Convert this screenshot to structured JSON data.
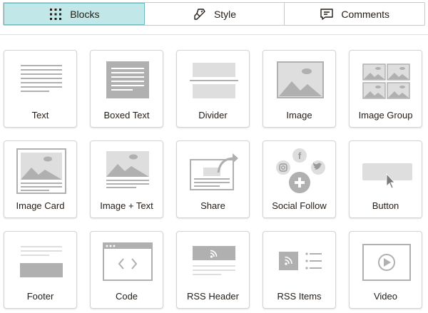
{
  "tabs": [
    {
      "label": "Blocks",
      "icon": "grid-dots-icon",
      "active": true
    },
    {
      "label": "Style",
      "icon": "paint-roller-icon",
      "active": false
    },
    {
      "label": "Comments",
      "icon": "comment-icon",
      "active": false
    }
  ],
  "colors": {
    "active_tab_bg": "#c2e7e8",
    "active_tab_border": "#6fbcc0",
    "icon_gray": "#b0b0b0",
    "text": "#241c15"
  },
  "blocks": [
    {
      "label": "Text",
      "icon": "text-block-icon"
    },
    {
      "label": "Boxed Text",
      "icon": "boxed-text-icon"
    },
    {
      "label": "Divider",
      "icon": "divider-icon"
    },
    {
      "label": "Image",
      "icon": "image-icon"
    },
    {
      "label": "Image Group",
      "icon": "image-group-icon"
    },
    {
      "label": "Image Card",
      "icon": "image-card-icon"
    },
    {
      "label": "Image + Text",
      "icon": "image-text-icon"
    },
    {
      "label": "Share",
      "icon": "share-icon"
    },
    {
      "label": "Social Follow",
      "icon": "social-follow-icon"
    },
    {
      "label": "Button",
      "icon": "button-icon"
    },
    {
      "label": "Footer",
      "icon": "footer-icon"
    },
    {
      "label": "Code",
      "icon": "code-icon"
    },
    {
      "label": "RSS Header",
      "icon": "rss-header-icon"
    },
    {
      "label": "RSS Items",
      "icon": "rss-items-icon"
    },
    {
      "label": "Video",
      "icon": "video-icon"
    }
  ]
}
